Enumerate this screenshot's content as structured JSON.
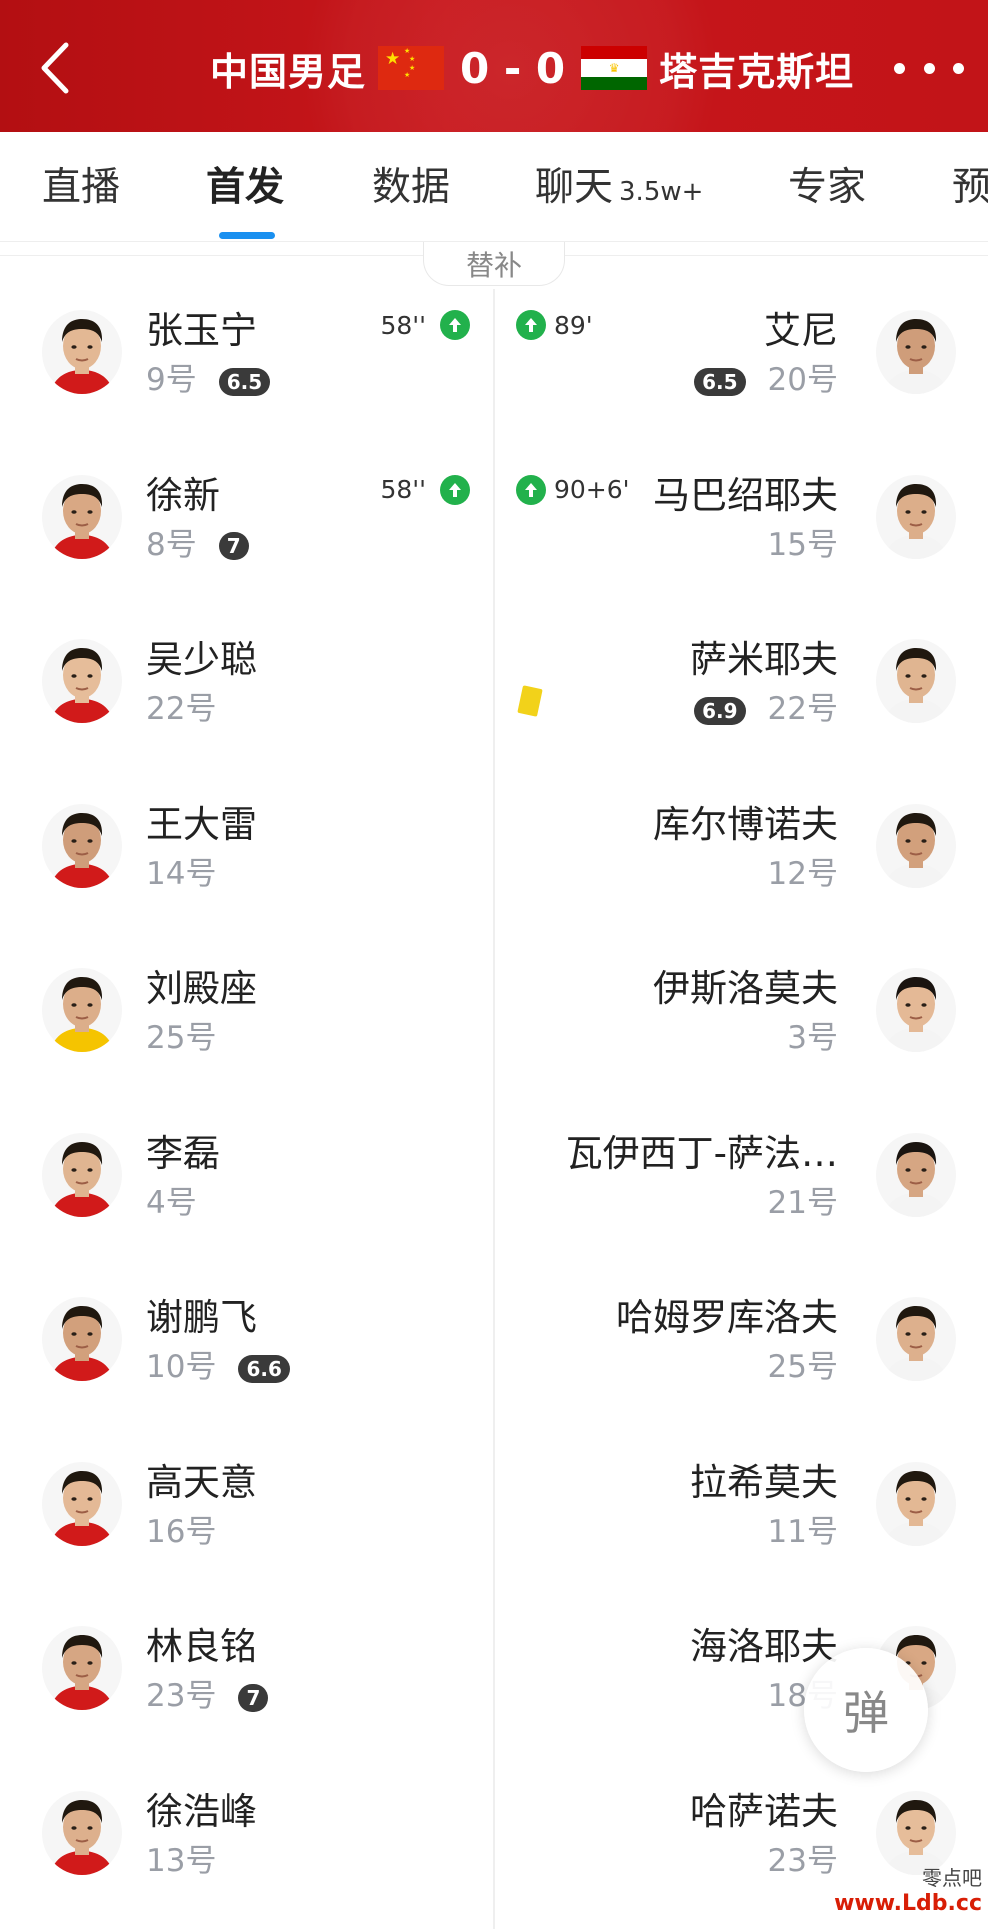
{
  "header": {
    "home_team": "中国男足",
    "away_team": "塔吉克斯坦",
    "score": "0 - 0",
    "colors": {
      "header_bg": "#c8161b",
      "accent": "#1a90f0",
      "sub_icon": "#22b14c",
      "yellow_card": "#f2d21a"
    }
  },
  "tabs": [
    {
      "label": "直播"
    },
    {
      "label": "首发",
      "active": true
    },
    {
      "label": "数据"
    },
    {
      "label": "聊天",
      "sub": "3.5w+"
    },
    {
      "label": "专家"
    },
    {
      "label": "预"
    }
  ],
  "lineup": {
    "bench_label": "替补",
    "home": [
      {
        "name": "张玉宁",
        "number": "9号",
        "rating": "6.5",
        "sub_time": "58''",
        "sub_icon": "substitution-up-icon"
      },
      {
        "name": "徐新",
        "number": "8号",
        "rating": "7",
        "sub_time": "58''",
        "sub_icon": "substitution-up-icon"
      },
      {
        "name": "吴少聪",
        "number": "22号"
      },
      {
        "name": "王大雷",
        "number": "14号"
      },
      {
        "name": "刘殿座",
        "number": "25号"
      },
      {
        "name": "李磊",
        "number": "4号"
      },
      {
        "name": "谢鹏飞",
        "number": "10号",
        "rating": "6.6"
      },
      {
        "name": "高天意",
        "number": "16号"
      },
      {
        "name": "林良铭",
        "number": "23号",
        "rating": "7"
      },
      {
        "name": "徐浩峰",
        "number": "13号"
      }
    ],
    "away": [
      {
        "name": "艾尼",
        "number": "20号",
        "rating": "6.5",
        "sub_time": "89'",
        "sub_icon": "substitution-up-icon"
      },
      {
        "name": "马巴绍耶夫",
        "number": "15号",
        "sub_time": "90+6'",
        "sub_icon": "substitution-up-icon"
      },
      {
        "name": "萨米耶夫",
        "number": "22号",
        "rating": "6.9",
        "card": "yellow-card-icon"
      },
      {
        "name": "库尔博诺夫",
        "number": "12号"
      },
      {
        "name": "伊斯洛莫夫",
        "number": "3号"
      },
      {
        "name": "瓦伊西丁-萨法…",
        "number": "21号"
      },
      {
        "name": "哈姆罗库洛夫",
        "number": "25号"
      },
      {
        "name": "拉希莫夫",
        "number": "11号"
      },
      {
        "name": "海洛耶夫",
        "number": "18号"
      },
      {
        "name": "哈萨诺夫",
        "number": "23号"
      }
    ]
  },
  "float_button": {
    "label": "弹"
  },
  "watermark": {
    "line1": "零点吧",
    "line2": "www.Ldb.cc"
  }
}
